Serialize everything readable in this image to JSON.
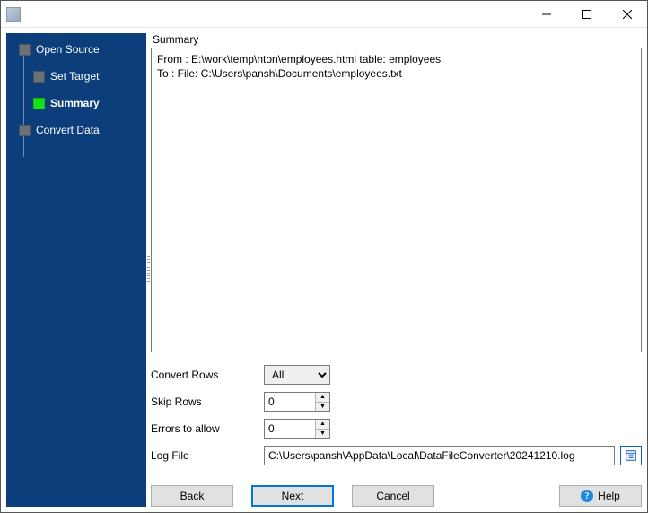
{
  "steps": [
    {
      "label": "Open Source",
      "sub": false,
      "active": false
    },
    {
      "label": "Set Target",
      "sub": true,
      "active": false
    },
    {
      "label": "Summary",
      "sub": true,
      "active": true
    },
    {
      "label": "Convert Data",
      "sub": false,
      "active": false
    }
  ],
  "main": {
    "section_label": "Summary",
    "summary_text": "From : E:\\work\\temp\\nton\\employees.html table: employees\nTo : File: C:\\Users\\pansh\\Documents\\employees.txt"
  },
  "form": {
    "convert_rows": {
      "label": "Convert Rows",
      "value": "All"
    },
    "skip_rows": {
      "label": "Skip Rows",
      "value": "0"
    },
    "errors": {
      "label": "Errors to allow",
      "value": "0"
    },
    "log": {
      "label": "Log File",
      "value": "C:\\Users\\pansh\\AppData\\Local\\DataFileConverter\\20241210.log"
    }
  },
  "buttons": {
    "back": "Back",
    "next": "Next",
    "cancel": "Cancel",
    "help": "Help"
  }
}
